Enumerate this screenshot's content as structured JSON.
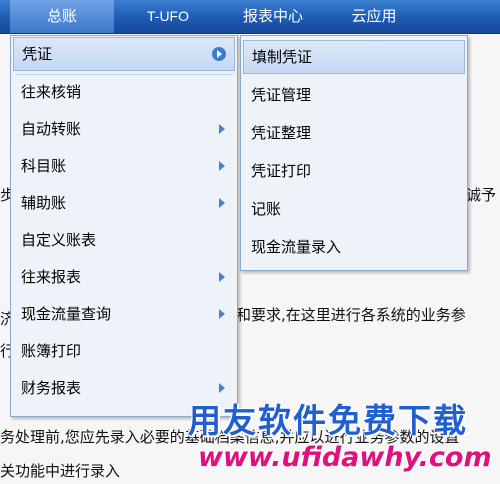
{
  "menubar": {
    "items": [
      {
        "label": "总账",
        "active": true
      },
      {
        "label": "T-UFO"
      },
      {
        "label": "报表中心"
      },
      {
        "label": "云应用"
      }
    ]
  },
  "main_menu": {
    "items": [
      {
        "label": "凭证",
        "submenu": true,
        "highlighted": true
      },
      {
        "label": "往来核销"
      },
      {
        "label": "自动转账",
        "submenu": true
      },
      {
        "label": "科目账",
        "submenu": true
      },
      {
        "label": "辅助账",
        "submenu": true
      },
      {
        "label": "自定义账表"
      },
      {
        "label": "往来报表",
        "submenu": true
      },
      {
        "label": "现金流量查询",
        "submenu": true
      },
      {
        "label": "账簿打印"
      },
      {
        "label": "财务报表",
        "submenu": true
      }
    ]
  },
  "sub_menu": {
    "items": [
      {
        "label": "填制凭证",
        "highlighted": true
      },
      {
        "label": "凭证管理"
      },
      {
        "label": "凭证整理"
      },
      {
        "label": "凭证打印"
      },
      {
        "label": "记账"
      },
      {
        "label": "现金流量录入"
      }
    ]
  },
  "background": {
    "fragments": [
      "步",
      "诚予",
      "济",
      "和要求,在这里进行各系统的业务参",
      "行",
      "务处理前,您应先录入必要的基础档案信息,并应以进行业务参数的设置",
      "关功能中进行录入"
    ]
  },
  "watermark": {
    "cn": "用友软件免费下载",
    "url": "www.ufidawhy.com"
  },
  "colors": {
    "menubar": "#1d5bb4",
    "highlight": "#c4d7f0",
    "watermark_cn": "#1f5fd0",
    "watermark_url": "#e0107c"
  }
}
